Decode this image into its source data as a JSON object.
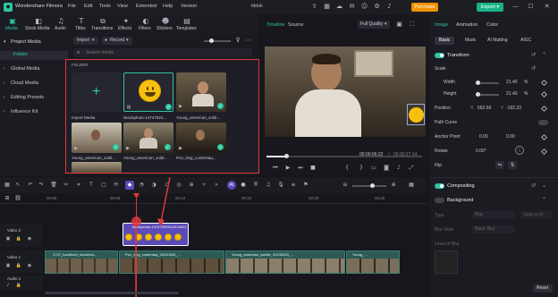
{
  "titlebar": {
    "app_name": "Wondershare Filmora",
    "menu": [
      "File",
      "Edit",
      "Tools",
      "View",
      "Extended",
      "Help",
      "Version"
    ],
    "project": "tiktok",
    "purchase": "Purchase",
    "export": "Export"
  },
  "toolbar": {
    "tabs": [
      "Media",
      "Stock Media",
      "Audio",
      "Titles",
      "Transitions",
      "Effects",
      "Filters",
      "Stickers",
      "Templates"
    ]
  },
  "left_nav": {
    "items": [
      "Project Media",
      "Folder",
      "Global Media",
      "Cloud Media",
      "Editing Presets",
      "Influence Kit"
    ]
  },
  "media_panel": {
    "import_label": "Import",
    "record_label": "Record",
    "search_placeholder": "Search media",
    "folder_header": "FOLDER",
    "items": [
      {
        "label": "Import Media"
      },
      {
        "label": "istockphoto-14747922..."
      },
      {
        "label": "Young_american_soldi..."
      },
      {
        "label": "Young_american_soldi..."
      },
      {
        "label": "Young_american_soldi..."
      },
      {
        "label": "Pov_vlog_contentaq..."
      }
    ]
  },
  "preview": {
    "tabs": [
      "Timeline",
      "Source"
    ],
    "quality": "Full Quality",
    "current_time": "00:00:06:22",
    "total_time": "00:00:27:14",
    "separator": "/"
  },
  "props": {
    "tabs": [
      "Image",
      "Animation",
      "Color"
    ],
    "subtabs": [
      "Basic",
      "Mask",
      "AI Matting",
      "AIGC"
    ],
    "transform": "Transform",
    "scale": "Scale",
    "width": "Width",
    "height": "Height",
    "width_val": "21.40",
    "height_val": "21.40",
    "position": "Position",
    "pos_x": "562.69",
    "pos_y": "-192.23",
    "path_curve": "Path Curve",
    "anchor": "Anchor Point",
    "anchor_x": "0.00",
    "anchor_y": "0.00",
    "rotate": "Rotate",
    "rotate_val": "0.00°",
    "flip": "Flip",
    "compositing": "Compositing",
    "background": "Background",
    "type_label": "Type",
    "type_val": "Blur",
    "blur_style": "Blur Style",
    "blur_style_val": "Basic Blur",
    "blur_level": "Level of Blur",
    "apply_all": "Apply to All",
    "reset": "Reset",
    "keyframe": "Keyframe"
  },
  "timeline": {
    "ruler": [
      "00:00",
      "00:05",
      "00:10",
      "00:15",
      "00:20",
      "00:25"
    ],
    "tracks": [
      "Video 2",
      "Video 1",
      "Audio 1"
    ],
    "clip_sticker": "istockphoto-1474792284-612x612",
    "clips_v1": [
      "1747_handheld_stockfoot...",
      "Pov_vlog_contentaq_20230525_...",
      "Young_american_soldier_20230523_...",
      "Young_..."
    ]
  },
  "colors": {
    "accent": "#2ec5a2",
    "purchase": "#f29100",
    "export": "#19b386",
    "red": "#e0383b",
    "sticker_clip": "#5a4bb8"
  }
}
